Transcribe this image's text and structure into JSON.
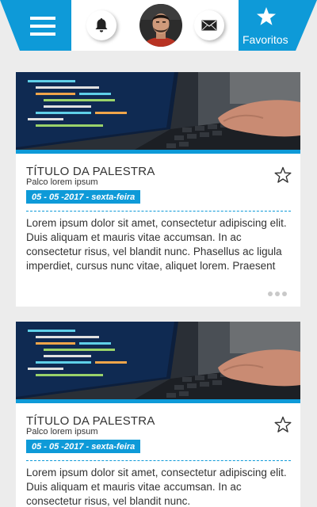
{
  "header": {
    "favorites_label": "Favoritos",
    "icons": {
      "menu": "hamburger-menu-icon",
      "notifications": "bell-icon",
      "avatar": "user-avatar",
      "messages": "envelope-icon",
      "favorites": "star-icon"
    }
  },
  "colors": {
    "accent": "#0e9ad8",
    "background": "#ececec",
    "card": "#ffffff",
    "text": "#333333"
  },
  "talks": [
    {
      "title": "TÍTULO DA PALESTRA",
      "subtitle": "Palco lorem ipsum",
      "date": "05 - 05 -2017 - sexta-feira",
      "description": "Lorem ipsum dolor sit amet, consectetur adipiscing elit. Duis aliquam et mauris vitae accumsan. In ac consectetur risus, vel blandit nunc. Phasellus ac ligula imperdiet, cursus nunc vitae, aliquet lorem. Praesent"
    },
    {
      "title": "TÍTULO DA PALESTRA",
      "subtitle": "Palco lorem ipsum",
      "date": "05 - 05 -2017 - sexta-feira",
      "description": "Lorem ipsum dolor sit amet, consectetur adipiscing elit. Duis aliquam et mauris vitae accumsan. In ac consectetur risus, vel blandit nunc."
    }
  ]
}
